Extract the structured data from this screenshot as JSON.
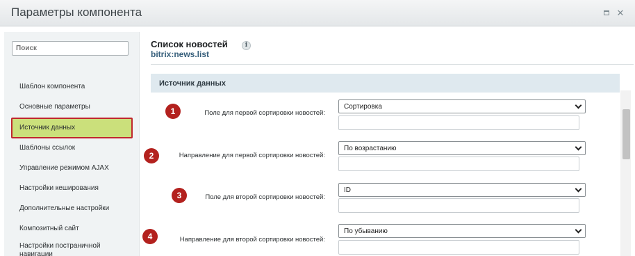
{
  "window": {
    "title": "Параметры компонента",
    "maximize_icon": "maximize-icon",
    "close_icon": "close-icon",
    "close_glyph": "✕"
  },
  "sidebar": {
    "search": {
      "placeholder": "Поиск",
      "value": ""
    },
    "items": [
      {
        "label": "Шаблон компонента"
      },
      {
        "label": "Основные параметры"
      },
      {
        "label": "Источник данных",
        "active": true
      },
      {
        "label": "Шаблоны ссылок"
      },
      {
        "label": "Управление режимом AJAX"
      },
      {
        "label": "Настройки кеширования"
      },
      {
        "label": "Дополнительные настройки"
      },
      {
        "label": "Композитный сайт"
      },
      {
        "label": "Настройки постраничной навигации"
      }
    ]
  },
  "component": {
    "title": "Список новостей",
    "code": "bitrix:news.list",
    "info_glyph": "i"
  },
  "section": {
    "title": "Источник данных"
  },
  "fields": [
    {
      "badge": "1",
      "label": "Поле для первой сортировки новостей:",
      "value": "Сортировка",
      "extra": ""
    },
    {
      "badge": "2",
      "label": "Направление для первой сортировки новостей:",
      "value": "По возрастанию",
      "extra": ""
    },
    {
      "badge": "3",
      "label": "Поле для второй сортировки новостей:",
      "value": "ID",
      "extra": ""
    },
    {
      "badge": "4",
      "label": "Направление для второй сортировки новостей:",
      "value": "По убыванию",
      "extra": ""
    }
  ],
  "colors": {
    "active_item": "#cbe07b",
    "highlight_border": "#c0272d",
    "badge": "#b3211e",
    "section_bg": "#dfe9ef"
  }
}
